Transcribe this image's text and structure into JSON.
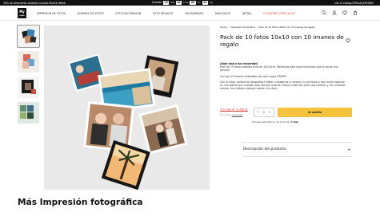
{
  "promo": {
    "left_text": "30% de descuento durante nuestra BLACK Week",
    "countdown_label": "Quedan",
    "countdown": [
      {
        "value": "22",
        "unit": "días"
      },
      {
        "value": "04",
        "unit": "horas"
      },
      {
        "value": "00",
        "unit": "min"
      },
      {
        "value": "22",
        "unit": "seg"
      }
    ],
    "right_text": "con el código MYBLACKFRIDAY"
  },
  "nav": {
    "logo": "My",
    "logo_sub": "Fujifilm",
    "items": [
      "IMPRESIÓN DE FOTOS",
      "ÁLBUMES DE FOTOS",
      "FOTO DECORACIÓN",
      "FOTO REGALOS",
      "CALENDARIOS",
      "ANALÓGICO",
      "INSTAX",
      "OCASIONES ESPECIALES"
    ],
    "icons": [
      "search-icon",
      "user-icon",
      "heart-icon",
      "cart-icon"
    ],
    "special_color": "#e0453b"
  },
  "breadcrumb": [
    "Home",
    "Impresión fotográfica",
    "Pack de 10 fotos 10x10 con 10 imanes de regalo"
  ],
  "product": {
    "title": "Pack de 10 fotos 10x10 con 10 imanes de regalo",
    "desc_heading": "¡Dale vida a tus recuerdos!",
    "desc_p1": "Pack de 10 fotos acabado brillo de 10x10cm. ¡Perfectas para esos momentos que te sacan una sonrisa!",
    "desc_p2": "¡Incluye 10 imanes imantados de color negro GRATIS!",
    "desc_p3": "Con la mejor calidad de fotografías Fujifilm, transforma tu nevera, tu escritorio o ese rincón especial en una galería que cambia cada vez que quieras. Porque cada foto tiene una historia, y con nuestros imanes, esa historia siempre estará a la vista!",
    "price_old": "22,00 € 2,00 €",
    "price_new": "",
    "price_sub_prefix": "IVA incluido",
    "price_sub_link": "+info envío",
    "qty": "1",
    "cart_label": "Al carrito",
    "delivery_prefix": "Entrega estimada en los próximos",
    "delivery_days": "3 días",
    "accordion_title": "Descripción del producto",
    "price_color": "#e0453b",
    "button_color": "#f6c33f"
  },
  "section": {
    "title": "Más Impresión fotográfica"
  }
}
